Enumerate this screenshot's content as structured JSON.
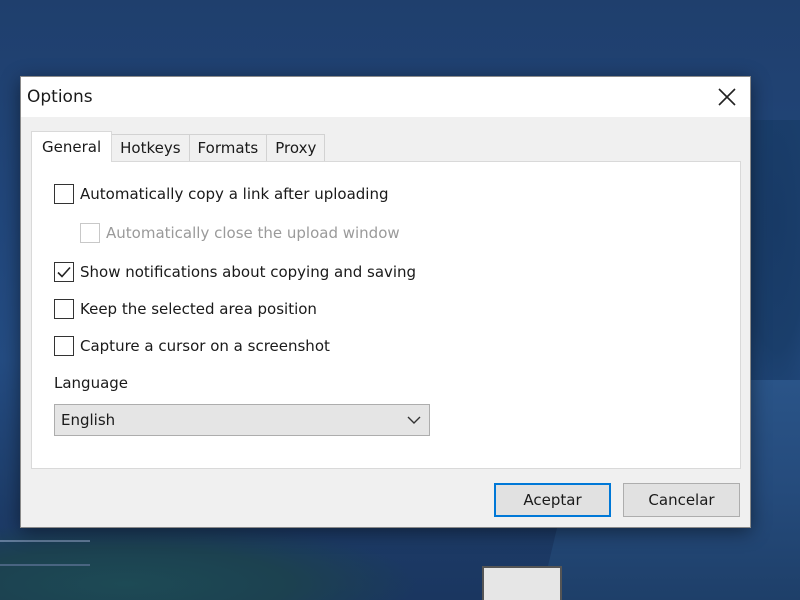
{
  "dialog": {
    "title": "Options",
    "close_icon": "close-icon"
  },
  "tabs": [
    {
      "label": "General",
      "active": true
    },
    {
      "label": "Hotkeys",
      "active": false
    },
    {
      "label": "Formats",
      "active": false
    },
    {
      "label": "Proxy",
      "active": false
    }
  ],
  "options": [
    {
      "label": "Automatically copy a link after uploading",
      "checked": false,
      "enabled": true
    },
    {
      "label": "Automatically close the upload window",
      "checked": false,
      "enabled": false
    },
    {
      "label": "Show notifications about copying and saving",
      "checked": true,
      "enabled": true
    },
    {
      "label": "Keep the selected area position",
      "checked": false,
      "enabled": true
    },
    {
      "label": "Capture a cursor on a screenshot",
      "checked": false,
      "enabled": true
    }
  ],
  "language": {
    "label": "Language",
    "selected": "English",
    "dropdown_icon": "chevron-down-icon"
  },
  "buttons": {
    "accept": "Aceptar",
    "cancel": "Cancelar"
  },
  "colors": {
    "accent": "#0078d7",
    "dialog_bg": "#f0f0f0",
    "panel_bg": "#ffffff"
  }
}
